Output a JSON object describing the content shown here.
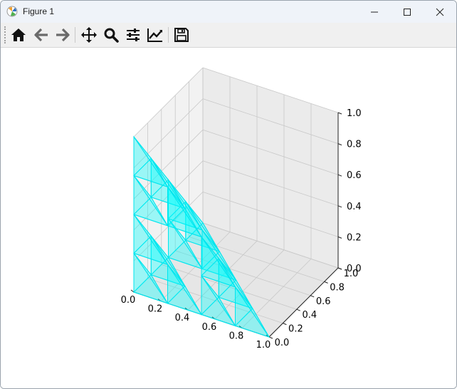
{
  "window": {
    "title": "Figure 1"
  },
  "toolbar": {
    "buttons": [
      {
        "name": "home-icon"
      },
      {
        "name": "back-icon"
      },
      {
        "name": "forward-icon"
      },
      {
        "name": "pan-icon"
      },
      {
        "name": "zoom-icon"
      },
      {
        "name": "subplots-icon"
      },
      {
        "name": "edit-axis-icon"
      },
      {
        "name": "save-icon"
      }
    ]
  },
  "chart_data": {
    "type": "3d-surface",
    "description_series": "Sierpinski tetrahedron (level 2) faces",
    "face_color": "#00ffff",
    "edge_color": "#00e5ee",
    "x_ticks": [
      "0.0",
      "0.2",
      "0.4",
      "0.6",
      "0.8",
      "1.0"
    ],
    "y_ticks": [
      "0.0",
      "0.2",
      "0.4",
      "0.6",
      "0.8",
      "1.0"
    ],
    "z_ticks": [
      "0.0",
      "0.2",
      "0.4",
      "0.6",
      "0.8",
      "1.0"
    ],
    "xlim": [
      0,
      1
    ],
    "ylim": [
      0,
      1
    ],
    "zlim": [
      0,
      1
    ],
    "grid": true
  }
}
